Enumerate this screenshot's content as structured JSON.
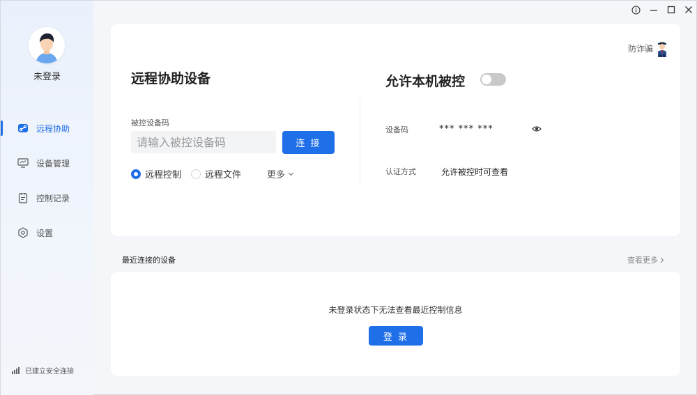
{
  "window": {
    "info_icon": "info-icon",
    "minimize_icon": "minimize-icon",
    "maximize_icon": "maximize-icon",
    "close_icon": "close-icon"
  },
  "sidebar": {
    "username": "未登录",
    "items": [
      {
        "label": "远程协助",
        "icon": "link-icon",
        "active": true
      },
      {
        "label": "设备管理",
        "icon": "monitor-icon",
        "active": false
      },
      {
        "label": "控制记录",
        "icon": "record-icon",
        "active": false
      },
      {
        "label": "设置",
        "icon": "gear-icon",
        "active": false
      }
    ],
    "status": "已建立安全连接"
  },
  "assist": {
    "title": "远程协助设备",
    "code_label": "被控设备码",
    "code_placeholder": "请输入被控设备码",
    "connect_label": "连 接",
    "options": [
      {
        "label": "远程控制",
        "checked": true
      },
      {
        "label": "远程文件",
        "checked": false
      }
    ],
    "more_label": "更多"
  },
  "allow": {
    "title": "允许本机被控",
    "enabled": false,
    "device_code_label": "设备码",
    "device_code_value": "*** *** ***",
    "auth_label": "认证方式",
    "auth_value": "允许被控时可查看"
  },
  "fraud": {
    "label": "防诈骗"
  },
  "recent": {
    "title": "最近连接的设备",
    "see_more": "查看更多",
    "empty_message": "未登录状态下无法查看最近控制信息",
    "login_label": "登 录"
  },
  "colors": {
    "accent": "#1e6fe8"
  }
}
